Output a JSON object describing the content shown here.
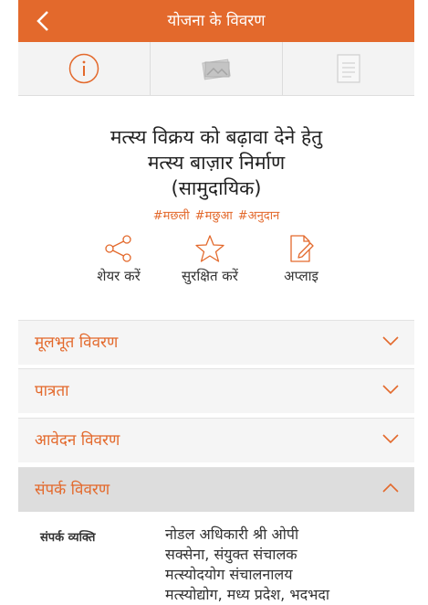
{
  "header": {
    "title": "योजना के विवरण"
  },
  "tabs": [
    {
      "icon": "info-icon"
    },
    {
      "icon": "image-icon"
    },
    {
      "icon": "document-icon"
    }
  ],
  "scheme": {
    "title_lines": [
      "मत्स्य विक्रय को बढ़ावा देने हेतु",
      "मत्स्य बाज़ार निर्माण",
      "(सामुदायिक)"
    ],
    "hashtags": [
      "#मछली",
      "#मछुआ",
      "#अनुदान"
    ]
  },
  "actions": {
    "share_label": "शेयर करें",
    "save_label": "सुरक्षित करें",
    "apply_label": "अप्लाइ"
  },
  "accordion": [
    {
      "label": "मूलभूत विवरण",
      "expanded": false
    },
    {
      "label": "पात्रता",
      "expanded": false
    },
    {
      "label": "आवेदन विवरण",
      "expanded": false
    },
    {
      "label": "संपर्क विवरण",
      "expanded": true
    }
  ],
  "contact": {
    "label": "संपर्क व्यक्ति",
    "value_lines": [
      "नोडल अधिकारी श्री ओपी",
      "सक्सेना, संयुक्त संचालक",
      "मत्स्योदयोग संचालनालय",
      "मत्स्योद्योग, मध्य प्रदेश, भदभदा"
    ]
  },
  "colors": {
    "accent": "#e3692c",
    "accordion_bg": "#f5f5f5",
    "accordion_active_bg": "#dddddd"
  }
}
